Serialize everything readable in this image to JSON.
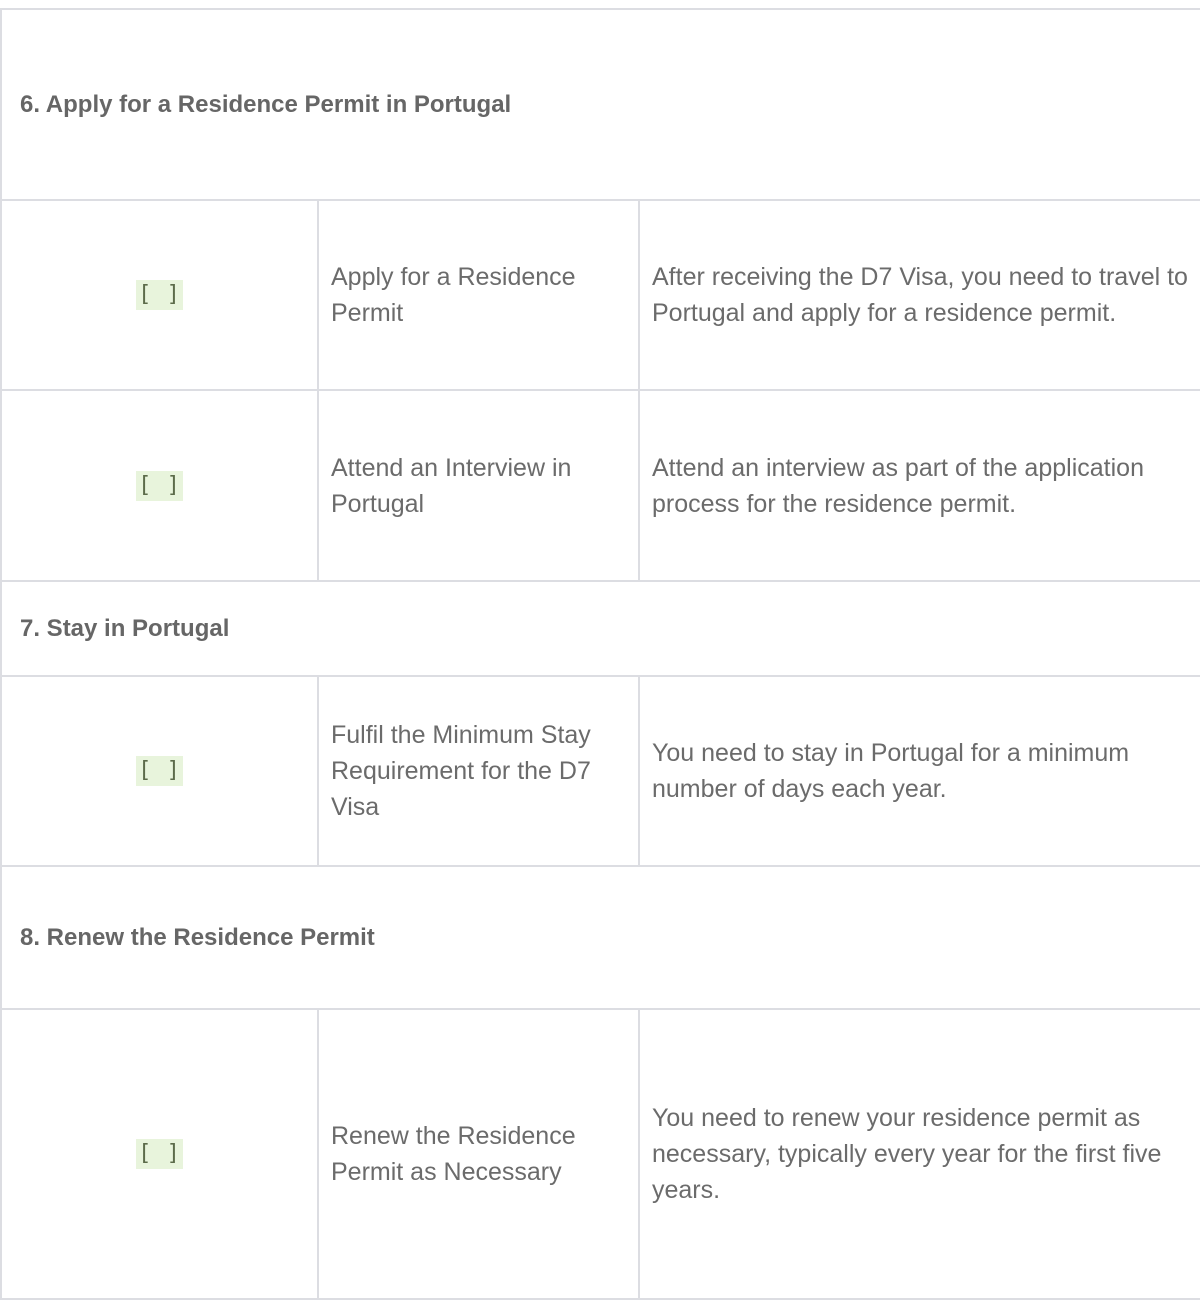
{
  "checkbox_glyph": "[ ]",
  "sections": [
    {
      "title": "6. Apply for a Residence Permit in Portugal",
      "tasks": [
        {
          "task": "Apply for a Residence Permit",
          "description": "After receiving the D7 Visa, you need to travel to Portugal and apply for a residence permit."
        },
        {
          "task": "Attend an Interview in Portugal",
          "description": "Attend an interview as part of the application process for the residence permit."
        }
      ]
    },
    {
      "title": "7. Stay in Portugal",
      "tasks": [
        {
          "task": "Fulfil the Minimum Stay Requirement for the D7 Visa",
          "description": "You need to stay in Portugal for a minimum number of days each year."
        }
      ]
    },
    {
      "title": "8. Renew the Residence Permit",
      "tasks": [
        {
          "task": "Renew the Residence Permit as Necessary",
          "description": "You need to renew your residence permit as necessary, typically every year for the first five years."
        }
      ]
    }
  ]
}
